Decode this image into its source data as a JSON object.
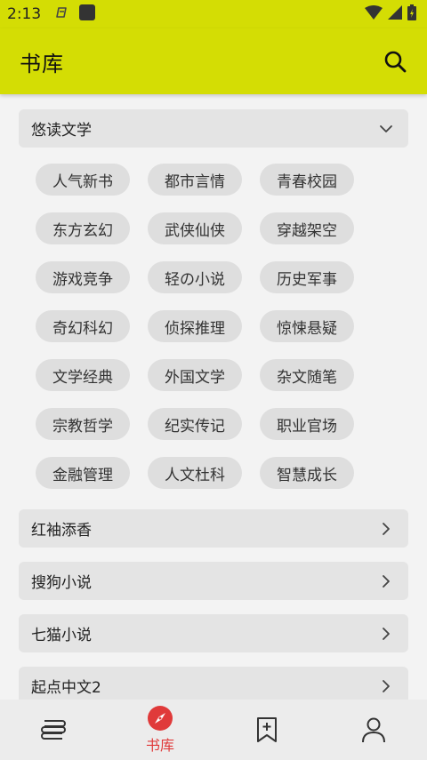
{
  "status": {
    "time": "2:13"
  },
  "header": {
    "title": "书库"
  },
  "sections": [
    {
      "title": "悠读文学",
      "expanded": true,
      "tags": [
        "人气新书",
        "都市言情",
        "青春校园",
        "东方玄幻",
        "武侠仙侠",
        "穿越架空",
        "游戏竞争",
        "轻の小说",
        "历史军事",
        "奇幻科幻",
        "侦探推理",
        "惊悚悬疑",
        "文学经典",
        "外国文学",
        "杂文随笔",
        "宗教哲学",
        "纪实传记",
        "职业官场",
        "金融管理",
        "人文杜科",
        "智慧成长"
      ]
    },
    {
      "title": "红袖添香",
      "expanded": false
    },
    {
      "title": "搜狗小说",
      "expanded": false
    },
    {
      "title": "七猫小说",
      "expanded": false
    },
    {
      "title": "起点中文2",
      "expanded": false
    }
  ],
  "bottom_nav": [
    {
      "icon": "stack-icon",
      "label": ""
    },
    {
      "icon": "compass-icon",
      "label": "书库",
      "active": true
    },
    {
      "icon": "bookmark-add-icon",
      "label": ""
    },
    {
      "icon": "person-icon",
      "label": ""
    }
  ],
  "colors": {
    "app_bar": "#d4dd04",
    "active_nav": "#e03a3a",
    "section_bg": "#e4e4e4",
    "tag_bg": "#dedede",
    "page_bg": "#f3f3f3"
  }
}
